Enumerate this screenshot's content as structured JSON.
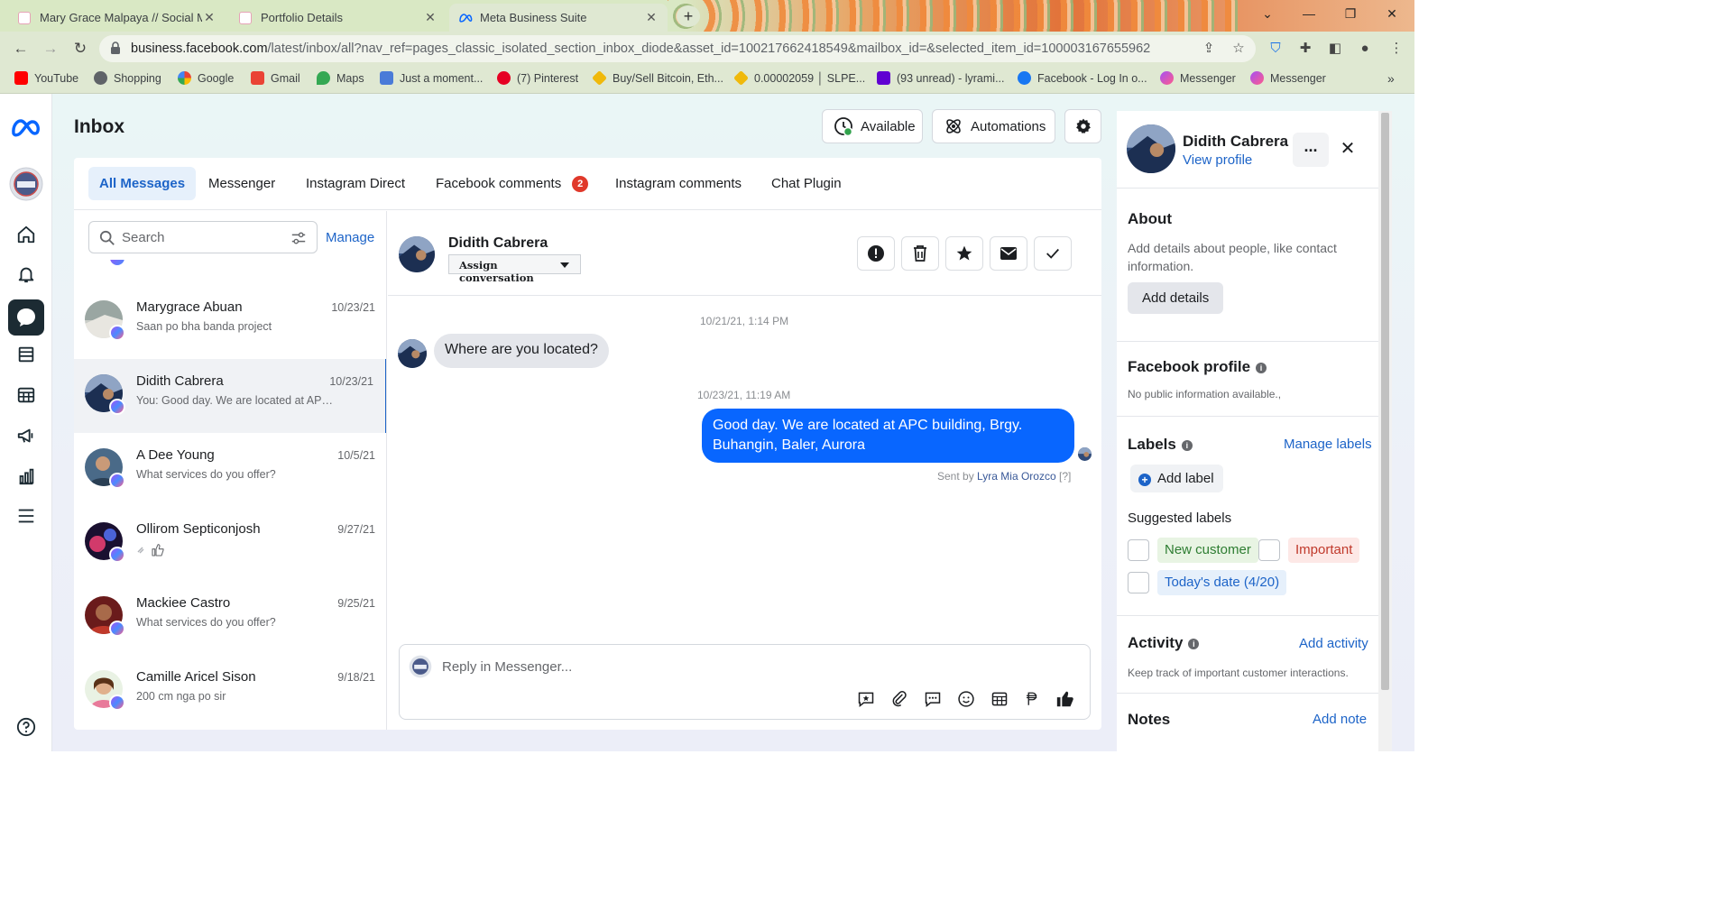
{
  "browser": {
    "tabs": [
      {
        "title": "Mary Grace Malpaya // Social Me",
        "active": false
      },
      {
        "title": "Portfolio Details",
        "active": false
      },
      {
        "title": "Meta Business Suite",
        "active": true
      }
    ],
    "url_host": "business.facebook.com",
    "url_rest": "/latest/inbox/all?nav_ref=pages_classic_isolated_section_inbox_diode&asset_id=100217662418549&mailbox_id=&selected_item_id=100003167655962",
    "bookmarks": [
      {
        "label": "YouTube",
        "color": "#ff0000"
      },
      {
        "label": "Shopping",
        "color": "#5f6368"
      },
      {
        "label": "Google",
        "color": "#4285f4"
      },
      {
        "label": "Gmail",
        "color": "#ea4335"
      },
      {
        "label": "Maps",
        "color": "#34a853"
      },
      {
        "label": "Just a moment...",
        "color": "#4a7bd8"
      },
      {
        "label": "(7) Pinterest",
        "color": "#e60023"
      },
      {
        "label": "Buy/Sell Bitcoin, Eth...",
        "color": "#f0b90b"
      },
      {
        "label": "0.00002059 │ SLPE...",
        "color": "#f0b90b"
      },
      {
        "label": "(93 unread) - lyrami...",
        "color": "#6001d2"
      },
      {
        "label": "Facebook - Log In o...",
        "color": "#1877f2"
      },
      {
        "label": "Messenger",
        "color": "#a450f5"
      },
      {
        "label": "Messenger",
        "color": "#a450f5"
      }
    ]
  },
  "header": {
    "title": "Inbox",
    "available_label": "Available",
    "automations_label": "Automations"
  },
  "tabs": [
    {
      "label": "All Messages",
      "active": true
    },
    {
      "label": "Messenger"
    },
    {
      "label": "Instagram Direct"
    },
    {
      "label": "Facebook comments",
      "badge": "2"
    },
    {
      "label": "Instagram comments"
    },
    {
      "label": "Chat Plugin"
    }
  ],
  "list": {
    "search_placeholder": "Search",
    "manage_label": "Manage",
    "conversations": [
      {
        "name": "Marygrace Abuan",
        "date": "10/23/21",
        "preview": "Saan po bha banda project",
        "selected": false
      },
      {
        "name": "Didith Cabrera",
        "date": "10/23/21",
        "preview": "You: Good day. We are located at APC building, Brgy. Buhangin",
        "selected": true
      },
      {
        "name": "A Dee Young",
        "date": "10/5/21",
        "preview": "What services do you offer?",
        "selected": false
      },
      {
        "name": "Ollirom Septiconjosh",
        "date": "9/27/21",
        "preview": "",
        "selected": false
      },
      {
        "name": "Mackiee Castro",
        "date": "9/25/21",
        "preview": "What services do you offer?",
        "selected": false
      },
      {
        "name": "Camille Aricel Sison",
        "date": "9/18/21",
        "preview": "200 cm nga po sir",
        "selected": false
      }
    ]
  },
  "chat": {
    "contact_name": "Didith Cabrera",
    "assign_label": "Assign conversation",
    "messages": [
      {
        "timestamp": "10/21/21, 1:14 PM",
        "direction": "in",
        "text": "Where are you located?"
      },
      {
        "timestamp": "10/23/21, 11:19 AM",
        "direction": "out",
        "text": "Good day. We are located at APC building, Brgy. Buhangin, Baler, Aurora"
      }
    ],
    "sent_by_prefix": "Sent by",
    "sent_by_name": "Lyra Mia Orozco",
    "sent_by_suffix": "[?]",
    "reply_placeholder": "Reply in Messenger..."
  },
  "panel": {
    "name": "Didith Cabrera",
    "view_profile": "View profile",
    "more_label": "...",
    "about_title": "About",
    "about_text": "Add details about people, like contact information.",
    "add_details": "Add details",
    "fb_profile_title": "Facebook profile",
    "fb_profile_text": "No public information available.,",
    "labels_title": "Labels",
    "manage_labels": "Manage labels",
    "add_label": "Add label",
    "suggested_labels": "Suggested labels",
    "label_new_customer": "New customer",
    "label_important": "Important",
    "label_today": "Today's date (4/20)",
    "activity_title": "Activity",
    "add_activity": "Add activity",
    "activity_text": "Keep track of important customer interactions.",
    "notes_title": "Notes",
    "add_note": "Add note"
  },
  "colors": {
    "accent": "#1d64c8",
    "bubble_out": "#0866ff",
    "badge": "#e0392b",
    "online": "#31a24c"
  }
}
